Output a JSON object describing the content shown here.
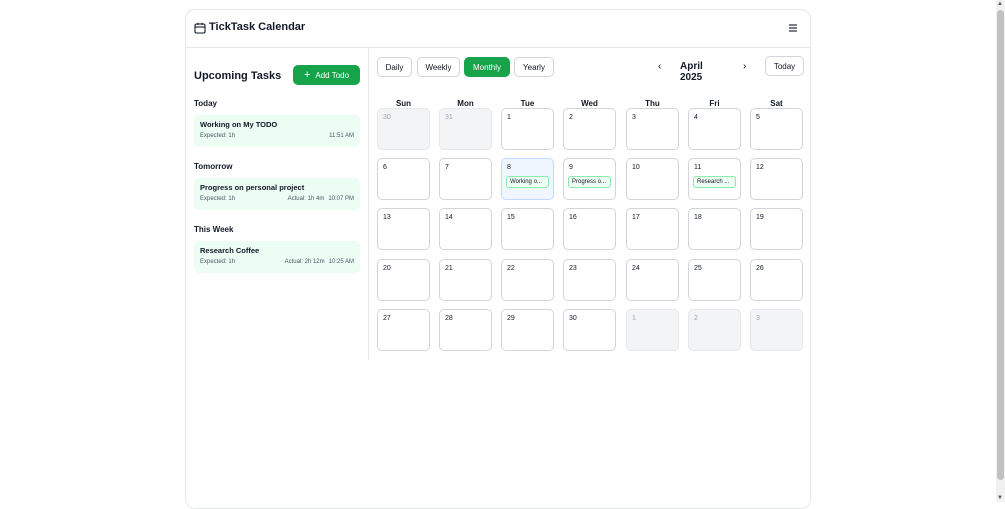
{
  "app": {
    "title": "TickTask Calendar"
  },
  "sidebar": {
    "title": "Upcoming Tasks",
    "add_label": "Add Todo",
    "sections": [
      {
        "label": "Today",
        "task": {
          "title": "Working on My TODO",
          "expected": "Expected: 1h",
          "actual": "",
          "time": "11:51 AM"
        }
      },
      {
        "label": "Tomorrow",
        "task": {
          "title": "Progress on personal project",
          "expected": "Expected: 1h",
          "actual": "Actual: 1h 4m",
          "time": "10:07 PM"
        }
      },
      {
        "label": "This Week",
        "task": {
          "title": "Research Coffee",
          "expected": "Expected: 1h",
          "actual": "Actual: 2h 12m",
          "time": "10:25 AM"
        }
      }
    ]
  },
  "toolbar": {
    "views": [
      "Daily",
      "Weekly",
      "Monthly",
      "Yearly"
    ],
    "active_view": "Monthly",
    "month": "April 2025",
    "prev": "‹",
    "next": "›",
    "today_label": "Today"
  },
  "calendar": {
    "weekdays": [
      "Sun",
      "Mon",
      "Tue",
      "Wed",
      "Thu",
      "Fri",
      "Sat"
    ],
    "weeks": [
      [
        {
          "d": "30",
          "out": true
        },
        {
          "d": "31",
          "out": true
        },
        {
          "d": "1"
        },
        {
          "d": "2"
        },
        {
          "d": "3"
        },
        {
          "d": "4"
        },
        {
          "d": "5"
        }
      ],
      [
        {
          "d": "6"
        },
        {
          "d": "7"
        },
        {
          "d": "8",
          "today": true,
          "evt": "Working o..."
        },
        {
          "d": "9",
          "evt": "Progress o..."
        },
        {
          "d": "10"
        },
        {
          "d": "11",
          "evt": "Research ..."
        },
        {
          "d": "12"
        }
      ],
      [
        {
          "d": "13"
        },
        {
          "d": "14"
        },
        {
          "d": "15"
        },
        {
          "d": "16"
        },
        {
          "d": "17"
        },
        {
          "d": "18"
        },
        {
          "d": "19"
        }
      ],
      [
        {
          "d": "20"
        },
        {
          "d": "21"
        },
        {
          "d": "22"
        },
        {
          "d": "23"
        },
        {
          "d": "24"
        },
        {
          "d": "25"
        },
        {
          "d": "26"
        }
      ],
      [
        {
          "d": "27"
        },
        {
          "d": "28"
        },
        {
          "d": "29"
        },
        {
          "d": "30"
        },
        {
          "d": "1",
          "out": true
        },
        {
          "d": "2",
          "out": true
        },
        {
          "d": "3",
          "out": true
        }
      ]
    ]
  },
  "colors": {
    "accent": "#16a34a",
    "task_bg": "#ecfdf3",
    "today_bg": "#eff6ff"
  },
  "icons": {
    "logo": "calendar-icon",
    "menu": "hamburger-icon",
    "add": "plus-icon"
  }
}
